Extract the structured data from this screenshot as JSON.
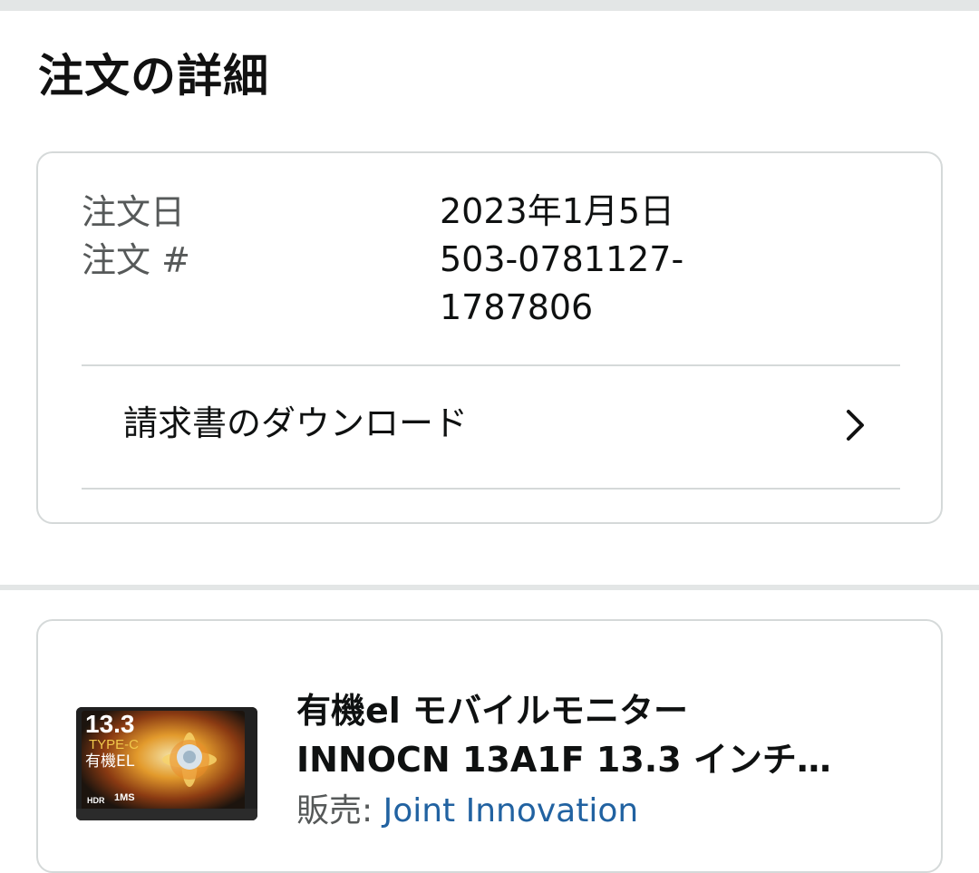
{
  "page": {
    "title": "注文の詳細"
  },
  "order_summary": {
    "order_date_label": "注文日",
    "order_date_value": "2023年1月5日",
    "order_number_label": "注文 #",
    "order_number_line1": "503-0781127-",
    "order_number_line2": "1787806",
    "invoice_download_label": "請求書のダウンロード",
    "chevron_icon": "chevron-right-icon"
  },
  "item": {
    "title_line1": "有機el モバイルモニター",
    "title_line2": "INNOCN 13A1F 13.3 インチ…",
    "seller_prefix": "販売: ",
    "seller_name": "Joint Innovation",
    "image_text": {
      "size": "13.3",
      "type": "TYPE-C",
      "panel": "有機EL",
      "hdr": "HDR",
      "response": "1MS"
    }
  },
  "colors": {
    "link": "#2162a1",
    "border": "#d5d9d9",
    "muted_text": "#565959",
    "separator": "#e3e6e6"
  }
}
